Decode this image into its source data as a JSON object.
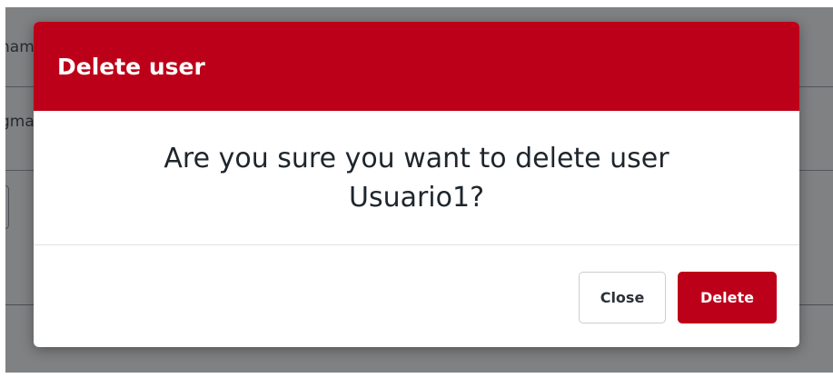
{
  "background": {
    "rows": [
      {
        "text": "nam"
      },
      {
        "text": "gma"
      }
    ]
  },
  "modal": {
    "title": "Delete user",
    "message": "Are you sure you want to delete user Usuario1?",
    "buttons": {
      "close_label": "Close",
      "delete_label": "Delete"
    }
  },
  "colors": {
    "accent": "#bd0019",
    "backdrop": "#16191d"
  }
}
